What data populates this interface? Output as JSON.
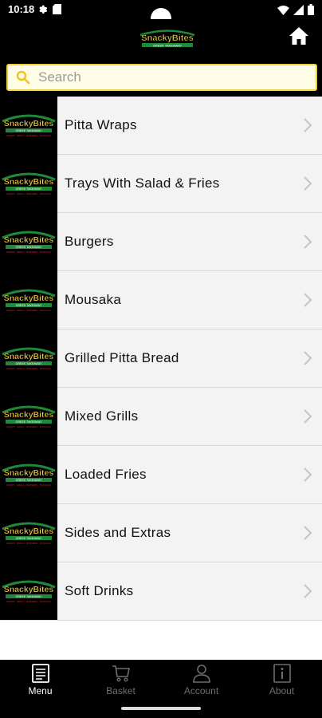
{
  "status_bar": {
    "time": "10:18",
    "left_icons": [
      "gear-icon",
      "sim-icon"
    ],
    "right_icons": [
      "wifi-icon",
      "signal-icon",
      "battery-icon"
    ]
  },
  "header": {
    "logo_text": "SnackyBites",
    "logo_tagline": "GREEK TAKEAWAY"
  },
  "search": {
    "placeholder": "Search",
    "value": ""
  },
  "thumb": {
    "logo_text": "SnackyBites",
    "logo_tagline": "GREEK TAKEAWAY",
    "logo_subline": "WRAPS · GRILLS · BURGERS · SOUVLAKI"
  },
  "menu": {
    "items": [
      {
        "label": "Pitta Wraps"
      },
      {
        "label": "Trays With Salad & Fries"
      },
      {
        "label": "Burgers"
      },
      {
        "label": "Mousaka"
      },
      {
        "label": "Grilled Pitta Bread"
      },
      {
        "label": "Mixed Grills"
      },
      {
        "label": "Loaded Fries"
      },
      {
        "label": "Sides and Extras"
      },
      {
        "label": "Soft Drinks"
      }
    ]
  },
  "bottom_nav": {
    "items": [
      {
        "label": "Menu",
        "icon": "menu-list-icon",
        "active": true
      },
      {
        "label": "Basket",
        "icon": "basket-icon",
        "active": false
      },
      {
        "label": "Account",
        "icon": "account-icon",
        "active": false
      },
      {
        "label": "About",
        "icon": "info-icon",
        "active": false
      }
    ]
  },
  "colors": {
    "brand_yellow": "#f1d13b",
    "brand_green": "#1e8a3a",
    "brand_red": "#d3252b",
    "list_bg": "#f3f3f3",
    "bar_bg": "#000000"
  }
}
